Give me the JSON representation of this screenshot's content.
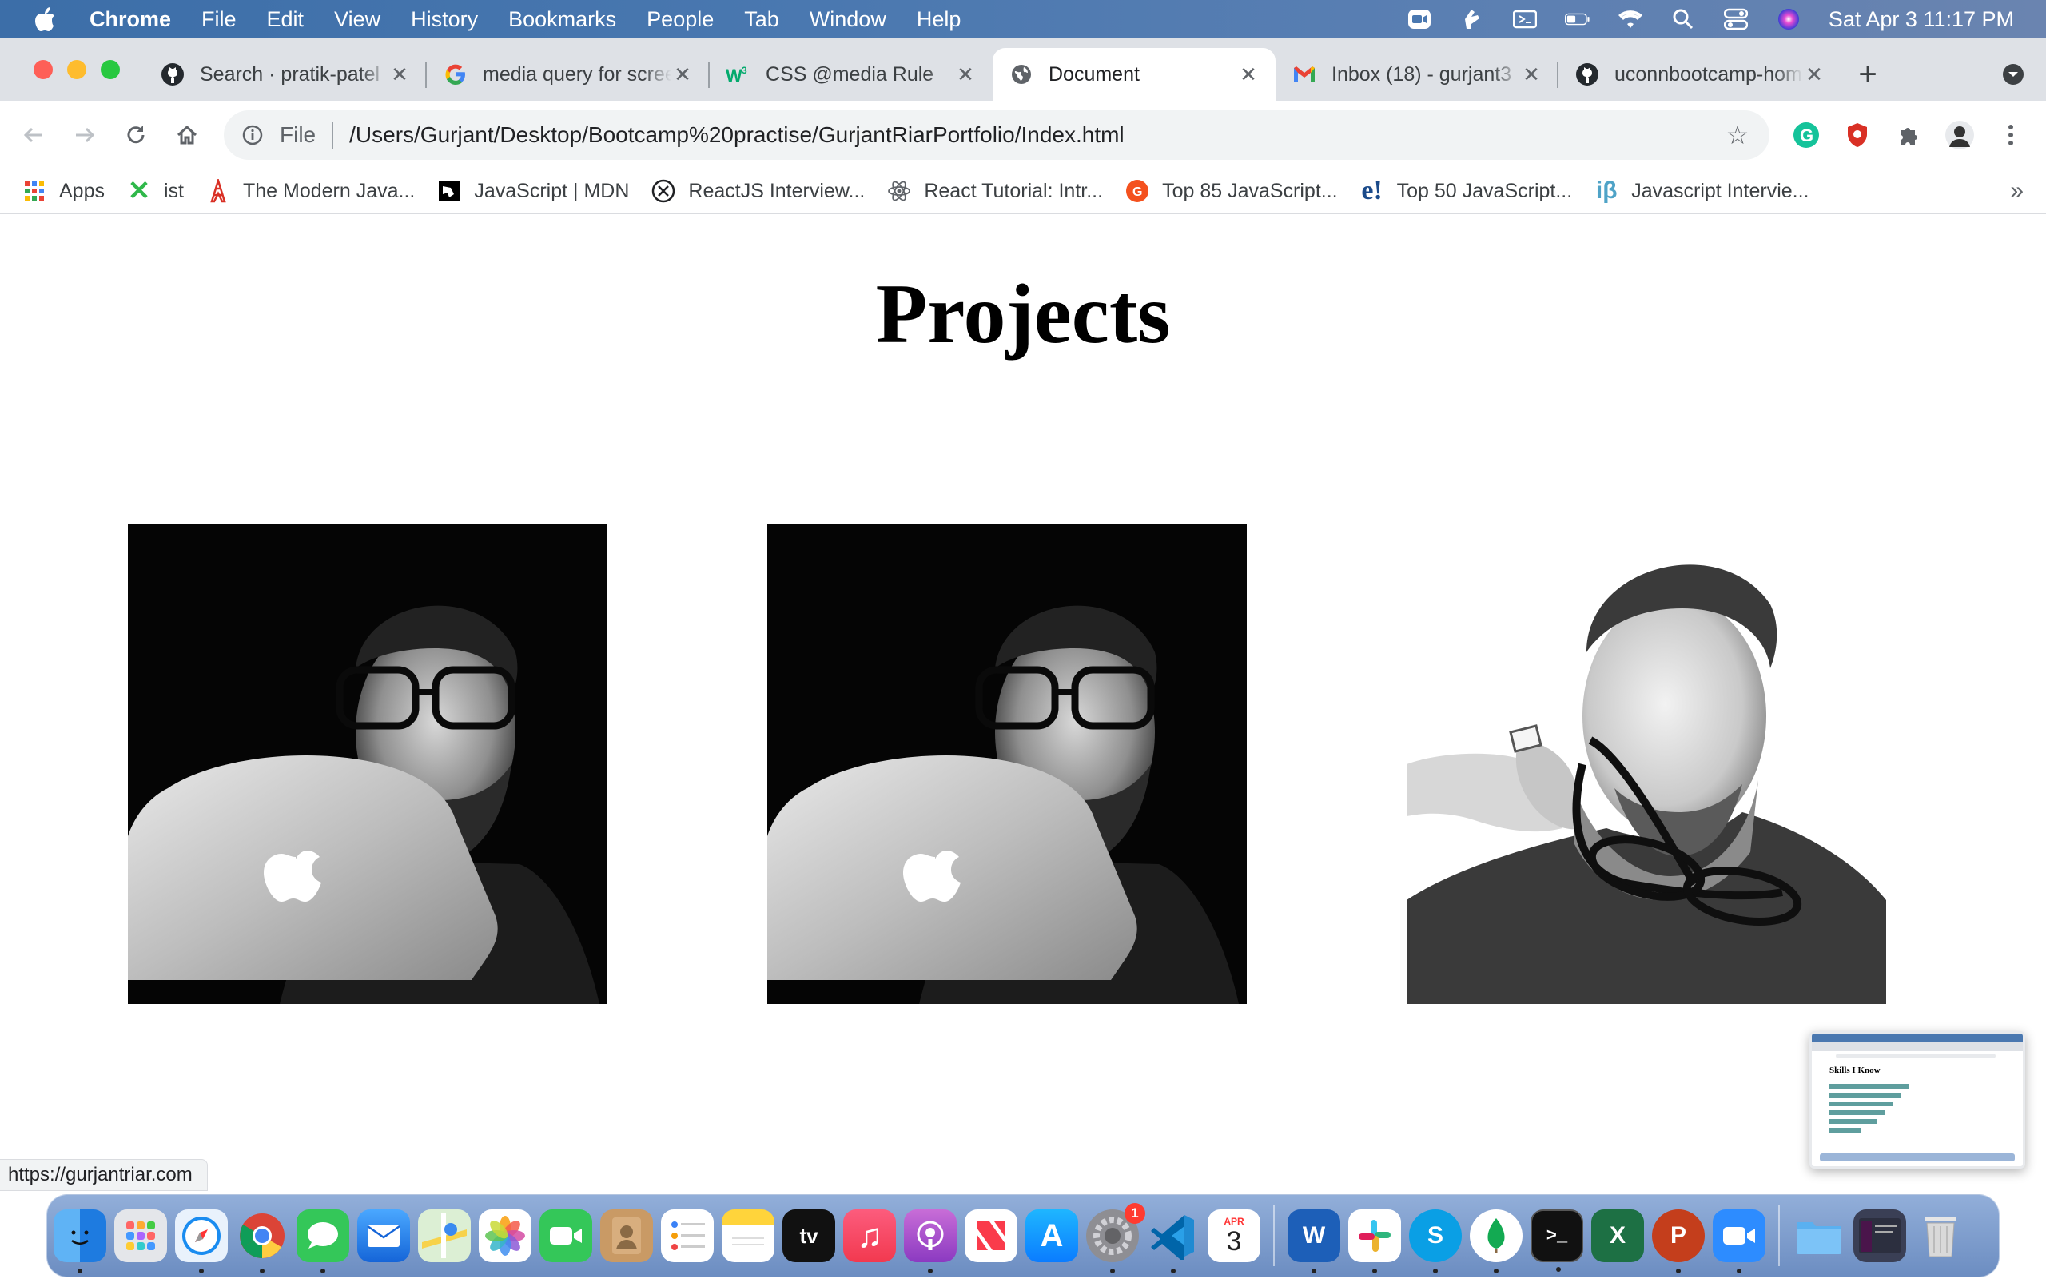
{
  "menubar": {
    "app_name": "Chrome",
    "items": [
      "File",
      "Edit",
      "View",
      "History",
      "Bookmarks",
      "People",
      "Tab",
      "Window",
      "Help"
    ],
    "clock": "Sat Apr 3  11:17 PM"
  },
  "tabs": [
    {
      "title": "Search · pratik-patel",
      "icon": "github-icon",
      "active": false
    },
    {
      "title": "media query for screen",
      "icon": "google-icon",
      "active": false
    },
    {
      "title": "CSS @media Rule",
      "icon": "w3schools-icon",
      "active": false
    },
    {
      "title": "Document",
      "icon": "globe-icon",
      "active": true
    },
    {
      "title": "Inbox (18) - gurjant3",
      "icon": "gmail-icon",
      "active": false
    },
    {
      "title": "uconnbootcamp-home",
      "icon": "github-icon",
      "active": false
    }
  ],
  "toolbar": {
    "scheme": "File",
    "url": "/Users/Gurjant/Desktop/Bootcamp%20practise/GurjantRiarPortfolio/Index.html"
  },
  "bookmarks": [
    {
      "label": "Apps",
      "icon": "apps-grid-icon"
    },
    {
      "label": "ist",
      "icon": "x-logo-icon"
    },
    {
      "label": "The Modern Java...",
      "icon": "tower-icon"
    },
    {
      "label": "JavaScript | MDN",
      "icon": "mdn-icon"
    },
    {
      "label": "ReactJS Interview...",
      "icon": "x-circle-icon"
    },
    {
      "label": "React Tutorial: Intr...",
      "icon": "react-icon"
    },
    {
      "label": "Top 85 JavaScript...",
      "icon": "guru-icon"
    },
    {
      "label": "Top 50 JavaScript...",
      "icon": "edureka-icon"
    },
    {
      "label": "Javascript Intervie...",
      "icon": "ib-icon"
    }
  ],
  "page": {
    "heading": "Projects",
    "projects": [
      {
        "alt": "portrait with laptop",
        "style": "dark"
      },
      {
        "alt": "portrait with laptop",
        "style": "dark"
      },
      {
        "alt": "portrait with glasses",
        "style": "light"
      }
    ]
  },
  "status_url": "https://gurjantriar.com",
  "thumbnail": {
    "heading": "Skills I Know"
  },
  "dock": {
    "calendar_month": "APR",
    "calendar_day": "3",
    "settings_badge": "1"
  }
}
